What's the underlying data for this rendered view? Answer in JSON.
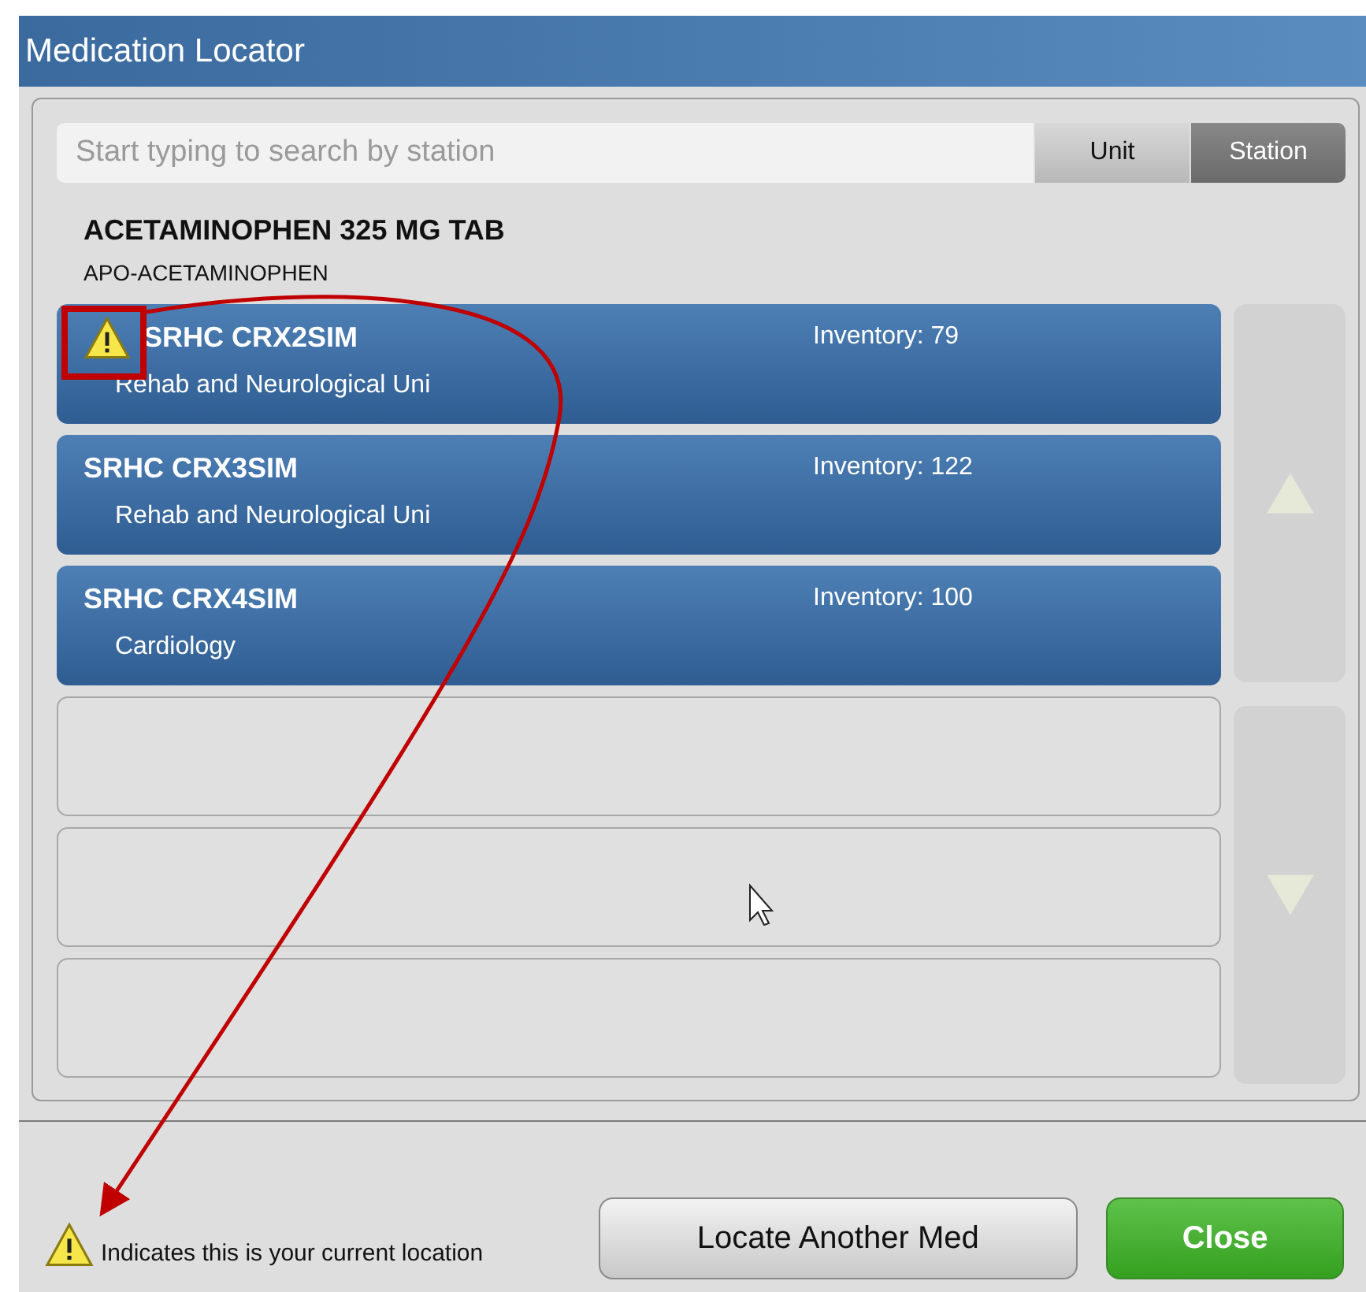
{
  "window": {
    "title": "Medication Locator"
  },
  "search": {
    "placeholder": "Start typing to search by station"
  },
  "tabs": [
    {
      "label": "Unit",
      "selected": false
    },
    {
      "label": "Station",
      "selected": true
    }
  ],
  "medication": {
    "name": "ACETAMINOPHEN 325 MG TAB",
    "brand": "APO-ACETAMINOPHEN"
  },
  "stations": [
    {
      "name": "SRHC CRX2SIM",
      "unit": "Rehab and Neurological Uni",
      "inventory": "Inventory: 79",
      "current": true
    },
    {
      "name": "SRHC CRX3SIM",
      "unit": "Rehab and Neurological Uni",
      "inventory": "Inventory: 122",
      "current": false
    },
    {
      "name": "SRHC CRX4SIM",
      "unit": "Cardiology",
      "inventory": "Inventory: 100",
      "current": false
    }
  ],
  "legend": "Indicates this is your current location",
  "buttons": [
    {
      "label": "Locate Another Med",
      "kind": "secondary"
    },
    {
      "label": "Close",
      "kind": "primary"
    }
  ]
}
